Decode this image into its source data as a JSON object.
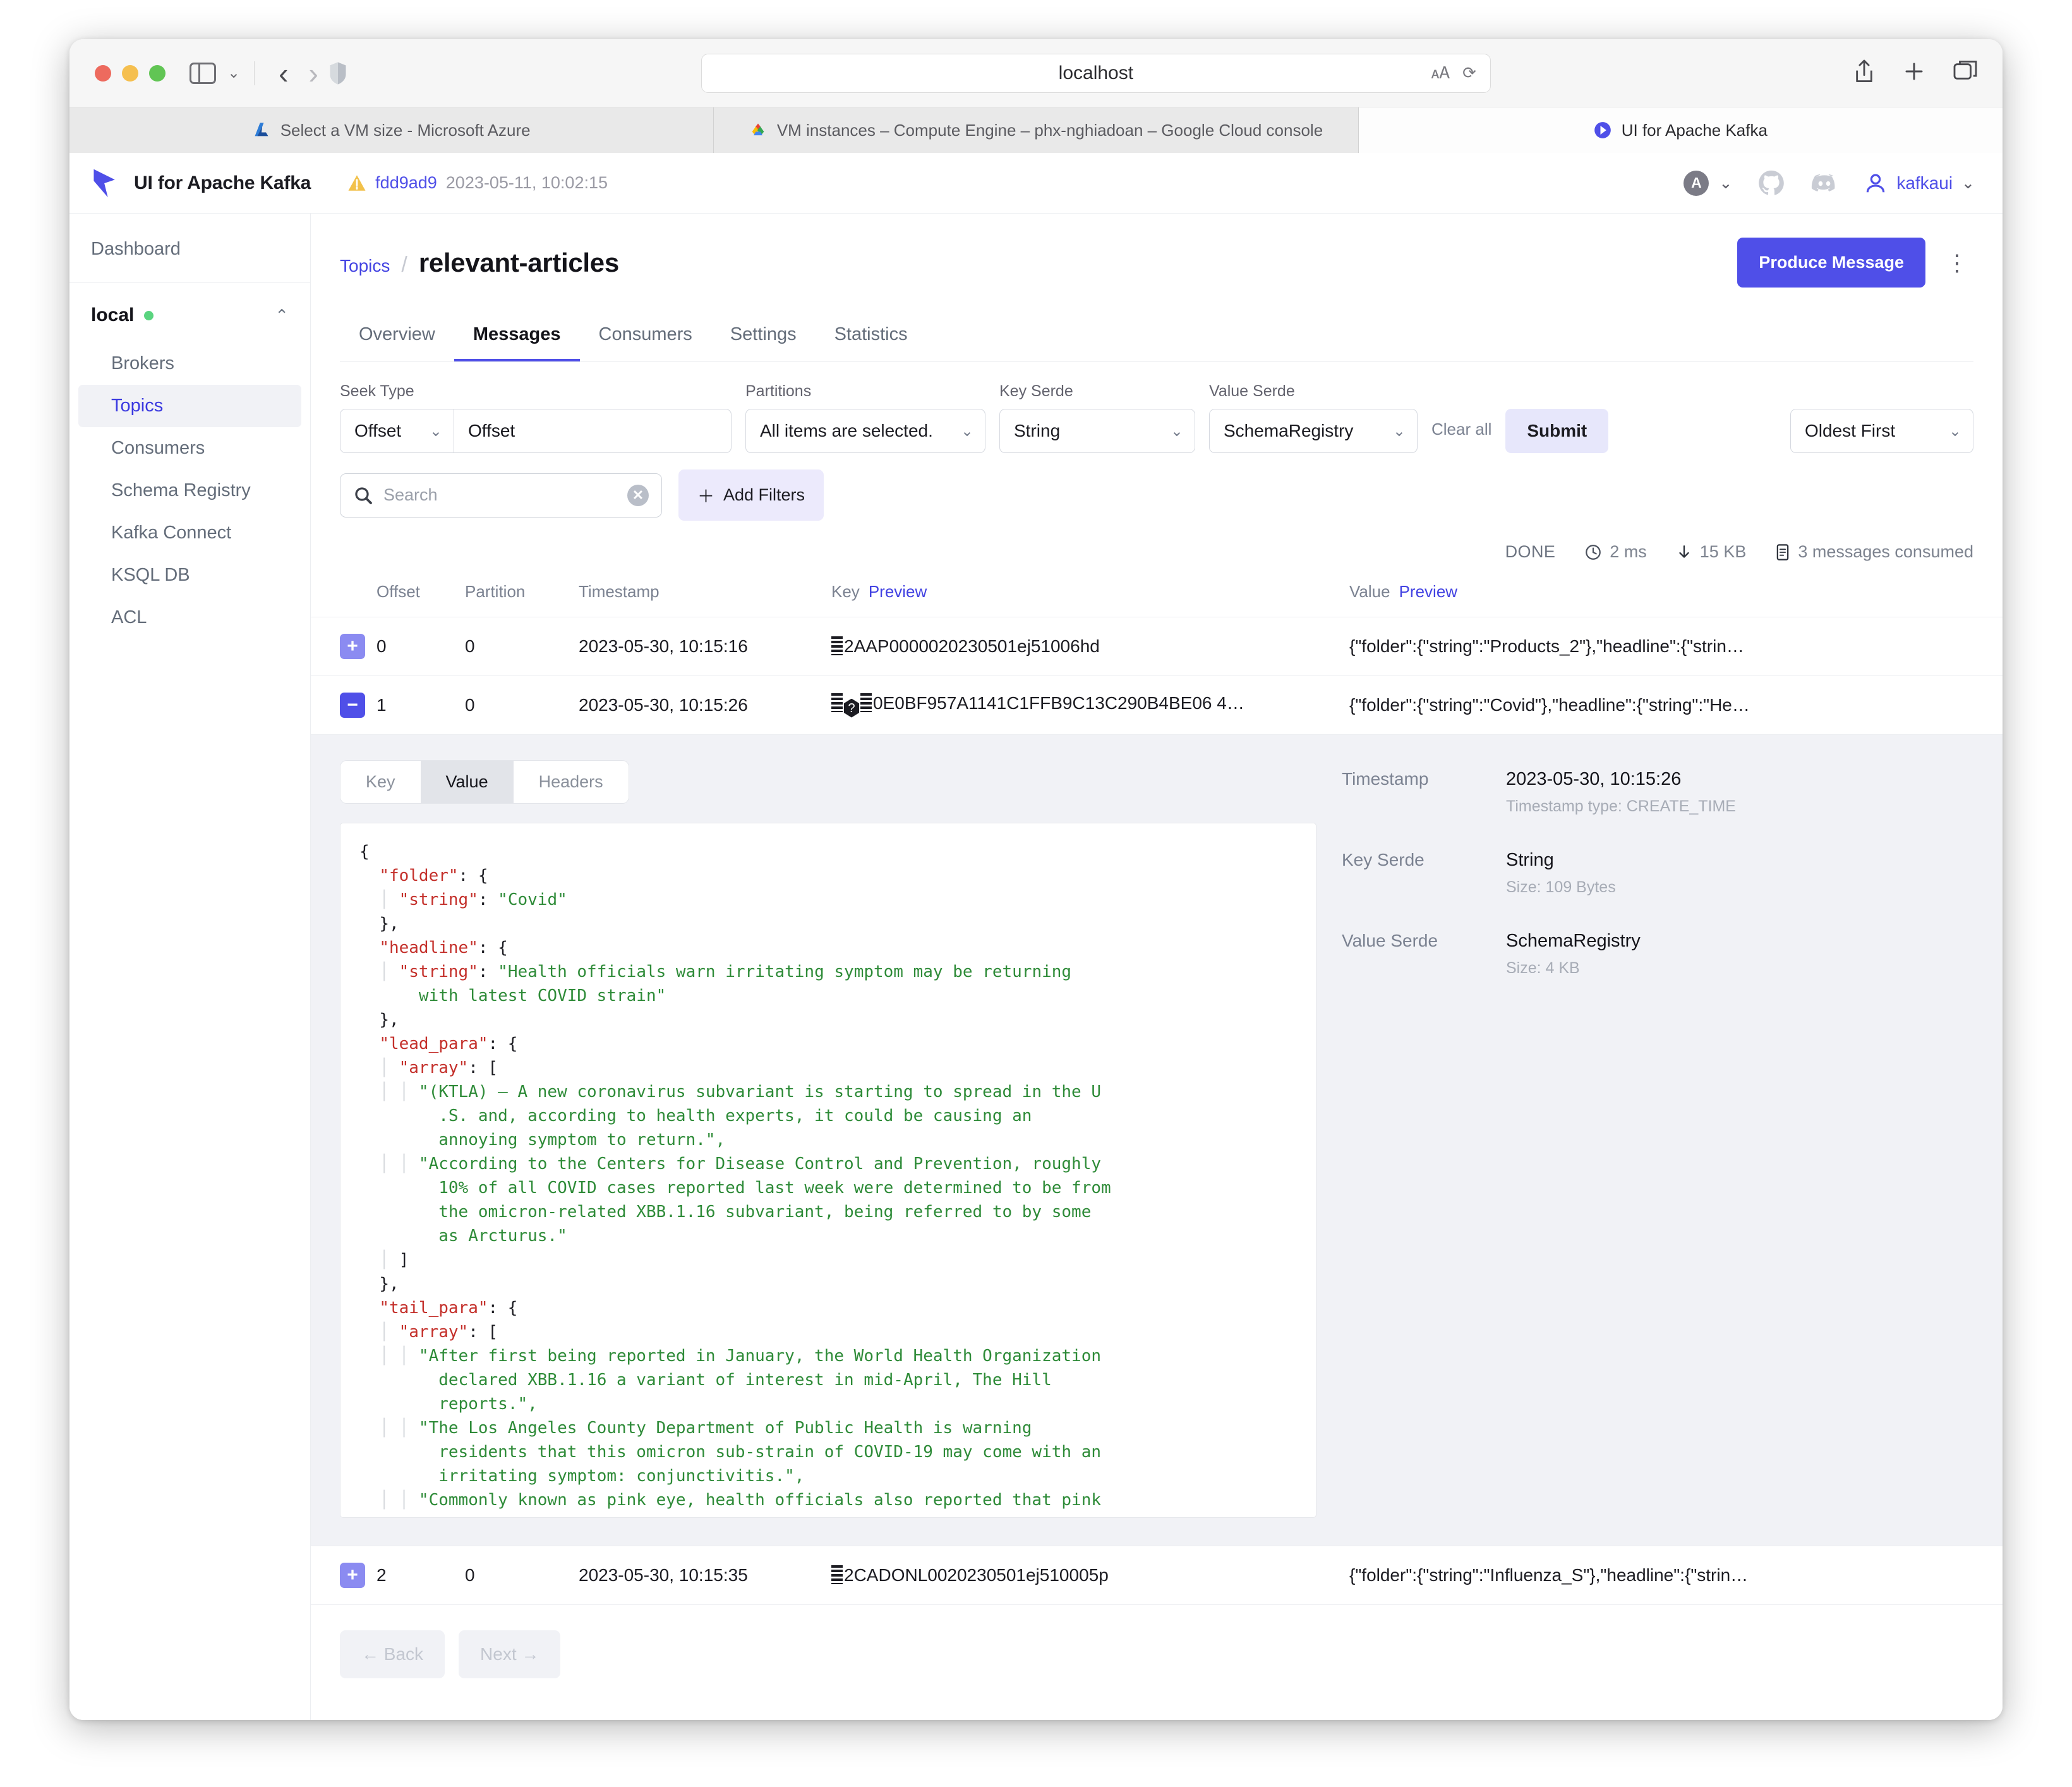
{
  "browser": {
    "url": "localhost",
    "tabs": [
      {
        "title": "Select a VM size - Microsoft Azure",
        "favicon": "azure-icon",
        "active": false
      },
      {
        "title": "VM instances – Compute Engine – phx-nghiadoan – Google Cloud console",
        "favicon": "google-cloud-icon",
        "active": false
      },
      {
        "title": "UI for Apache Kafka",
        "favicon": "kafka-ui-icon",
        "active": true
      }
    ]
  },
  "header": {
    "brand": "UI for Apache Kafka",
    "version_hash": "fdd9ad9",
    "version_date": "2023-05-11, 10:02:15",
    "avatar_letter": "A",
    "user": "kafkaui"
  },
  "sidebar": {
    "dashboard": "Dashboard",
    "cluster": "local",
    "items": [
      {
        "label": "Brokers",
        "active": false
      },
      {
        "label": "Topics",
        "active": true
      },
      {
        "label": "Consumers",
        "active": false
      },
      {
        "label": "Schema Registry",
        "active": false
      },
      {
        "label": "Kafka Connect",
        "active": false
      },
      {
        "label": "KSQL DB",
        "active": false
      },
      {
        "label": "ACL",
        "active": false
      }
    ]
  },
  "page": {
    "breadcrumb_parent": "Topics",
    "title": "relevant-articles",
    "produce_button": "Produce Message",
    "tabs": [
      {
        "label": "Overview",
        "active": false
      },
      {
        "label": "Messages",
        "active": true
      },
      {
        "label": "Consumers",
        "active": false
      },
      {
        "label": "Settings",
        "active": false
      },
      {
        "label": "Statistics",
        "active": false
      }
    ]
  },
  "filters": {
    "seek_type_label": "Seek Type",
    "seek_type_value": "Offset",
    "seek_value": "Offset",
    "partitions_label": "Partitions",
    "partitions_value": "All items are selected.",
    "key_serde_label": "Key Serde",
    "key_serde_value": "String",
    "value_serde_label": "Value Serde",
    "value_serde_value": "SchemaRegistry",
    "clear_all": "Clear all",
    "submit": "Submit",
    "order_value": "Oldest First",
    "search_placeholder": "Search",
    "add_filters": "Add Filters"
  },
  "status": {
    "state": "DONE",
    "elapsed": "2 ms",
    "size": "15 KB",
    "consumed": "3 messages consumed"
  },
  "table": {
    "headers": {
      "offset": "Offset",
      "partition": "Partition",
      "timestamp": "Timestamp",
      "key": "Key",
      "key_preview": "Preview",
      "value": "Value",
      "value_preview": "Preview"
    },
    "rows": [
      {
        "toggle": "+",
        "offset": "0",
        "partition": "0",
        "timestamp": "2023-05-30, 10:15:16",
        "key": "2AAP0000020230501ej51006hd",
        "key_prefix": "bin",
        "value": "{\"folder\":{\"string\":\"Products_2\"},\"headline\":{\"strin…"
      },
      {
        "toggle": "−",
        "offset": "1",
        "partition": "0",
        "timestamp": "2023-05-30, 10:15:26",
        "key": "0E0BF957A1141C1FFB9C13C290B4BE06 4…",
        "key_prefix": "bin-q-bin",
        "value": "{\"folder\":{\"string\":\"Covid\"},\"headline\":{\"string\":\"He…"
      },
      {
        "toggle": "+",
        "offset": "2",
        "partition": "0",
        "timestamp": "2023-05-30, 10:15:35",
        "key": "2CADONL0020230501ej510005p",
        "key_prefix": "bin",
        "value": "{\"folder\":{\"string\":\"Influenza_S\"},\"headline\":{\"strin…"
      }
    ]
  },
  "detail": {
    "segments": [
      {
        "label": "Key",
        "active": false
      },
      {
        "label": "Value",
        "active": true
      },
      {
        "label": "Headers",
        "active": false
      }
    ],
    "json_lines": [
      {
        "indent": 0,
        "guides": 0,
        "parts": [
          {
            "t": "p",
            "v": "{"
          }
        ]
      },
      {
        "indent": 1,
        "guides": 0,
        "parts": [
          {
            "t": "k",
            "v": "\"folder\""
          },
          {
            "t": "p",
            "v": ": {"
          }
        ]
      },
      {
        "indent": 2,
        "guides": 1,
        "parts": [
          {
            "t": "k",
            "v": "\"string\""
          },
          {
            "t": "p",
            "v": ": "
          },
          {
            "t": "s",
            "v": "\"Covid\""
          }
        ]
      },
      {
        "indent": 1,
        "guides": 0,
        "parts": [
          {
            "t": "p",
            "v": "},"
          }
        ]
      },
      {
        "indent": 1,
        "guides": 0,
        "parts": [
          {
            "t": "k",
            "v": "\"headline\""
          },
          {
            "t": "p",
            "v": ": {"
          }
        ]
      },
      {
        "indent": 2,
        "guides": 1,
        "parts": [
          {
            "t": "k",
            "v": "\"string\""
          },
          {
            "t": "p",
            "v": ": "
          },
          {
            "t": "s",
            "v": "\"Health officials warn irritating symptom may be returning"
          }
        ]
      },
      {
        "indent": 3,
        "guides": 0,
        "parts": [
          {
            "t": "s",
            "v": "with latest COVID strain\""
          }
        ]
      },
      {
        "indent": 1,
        "guides": 0,
        "parts": [
          {
            "t": "p",
            "v": "},"
          }
        ]
      },
      {
        "indent": 1,
        "guides": 0,
        "parts": [
          {
            "t": "k",
            "v": "\"lead_para\""
          },
          {
            "t": "p",
            "v": ": {"
          }
        ]
      },
      {
        "indent": 2,
        "guides": 1,
        "parts": [
          {
            "t": "k",
            "v": "\"array\""
          },
          {
            "t": "p",
            "v": ": ["
          }
        ]
      },
      {
        "indent": 3,
        "guides": 2,
        "parts": [
          {
            "t": "s",
            "v": "\"(KTLA) – A new coronavirus subvariant is starting to spread in the U"
          }
        ]
      },
      {
        "indent": 4,
        "guides": 0,
        "parts": [
          {
            "t": "s",
            "v": ".S. and, according to health experts, it could be causing an"
          }
        ]
      },
      {
        "indent": 4,
        "guides": 0,
        "parts": [
          {
            "t": "s",
            "v": "annoying symptom to return.\","
          }
        ]
      },
      {
        "indent": 3,
        "guides": 2,
        "parts": [
          {
            "t": "s",
            "v": "\"According to the Centers for Disease Control and Prevention, roughly"
          }
        ]
      },
      {
        "indent": 4,
        "guides": 0,
        "parts": [
          {
            "t": "s",
            "v": "10% of all COVID cases reported last week were determined to be from"
          }
        ]
      },
      {
        "indent": 4,
        "guides": 0,
        "parts": [
          {
            "t": "s",
            "v": "the omicron-related XBB.1.16 subvariant, being referred to by some"
          }
        ]
      },
      {
        "indent": 4,
        "guides": 0,
        "parts": [
          {
            "t": "s",
            "v": "as Arcturus.\""
          }
        ]
      },
      {
        "indent": 2,
        "guides": 1,
        "parts": [
          {
            "t": "p",
            "v": "]"
          }
        ]
      },
      {
        "indent": 1,
        "guides": 0,
        "parts": [
          {
            "t": "p",
            "v": "},"
          }
        ]
      },
      {
        "indent": 1,
        "guides": 0,
        "parts": [
          {
            "t": "k",
            "v": "\"tail_para\""
          },
          {
            "t": "p",
            "v": ": {"
          }
        ]
      },
      {
        "indent": 2,
        "guides": 1,
        "parts": [
          {
            "t": "k",
            "v": "\"array\""
          },
          {
            "t": "p",
            "v": ": ["
          }
        ]
      },
      {
        "indent": 3,
        "guides": 2,
        "parts": [
          {
            "t": "s",
            "v": "\"After first being reported in January, the World Health Organization"
          }
        ]
      },
      {
        "indent": 4,
        "guides": 0,
        "parts": [
          {
            "t": "s",
            "v": "declared XBB.1.16 a variant of interest in mid-April, The Hill"
          }
        ]
      },
      {
        "indent": 4,
        "guides": 0,
        "parts": [
          {
            "t": "s",
            "v": "reports.\","
          }
        ]
      },
      {
        "indent": 3,
        "guides": 2,
        "parts": [
          {
            "t": "s",
            "v": "\"The Los Angeles County Department of Public Health is warning"
          }
        ]
      },
      {
        "indent": 4,
        "guides": 0,
        "parts": [
          {
            "t": "s",
            "v": "residents that this omicron sub-strain of COVID-19 may come with an"
          }
        ]
      },
      {
        "indent": 4,
        "guides": 0,
        "parts": [
          {
            "t": "s",
            "v": "irritating symptom: conjunctivitis.\","
          }
        ]
      },
      {
        "indent": 3,
        "guides": 2,
        "parts": [
          {
            "t": "s",
            "v": "\"Commonly known as pink eye, health officials also reported that pink"
          }
        ]
      }
    ],
    "meta": [
      {
        "label": "Timestamp",
        "value": "2023-05-30, 10:15:26",
        "sub": "Timestamp type: CREATE_TIME"
      },
      {
        "label": "Key Serde",
        "value": "String",
        "sub": "Size: 109 Bytes"
      },
      {
        "label": "Value Serde",
        "value": "SchemaRegistry",
        "sub": "Size: 4 KB"
      }
    ]
  },
  "pager": {
    "back": "← Back",
    "next": "Next →"
  }
}
